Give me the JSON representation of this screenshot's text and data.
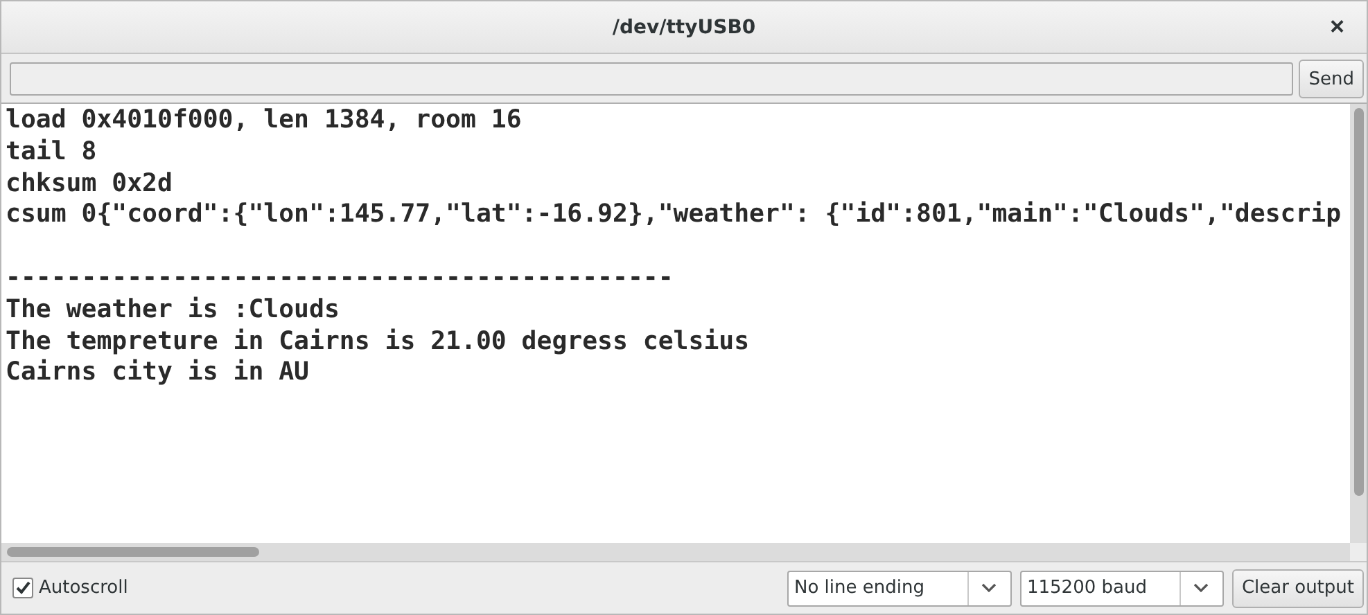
{
  "window": {
    "title": "/dev/ttyUSB0",
    "close": "×"
  },
  "send_bar": {
    "button": "Send"
  },
  "output": {
    "blocks": [
      [
        "load 0x4010f000, len 1384, room 16",
        "tail 8",
        "chksum 0x2d",
        "csum 0{\"coord\":{\"lon\":145.77,\"lat\":-16.92},\"weather\": {\"id\":801,\"main\":\"Clouds\",\"descrip"
      ],
      [
        "--------------------------------------------",
        "The weather is :Clouds",
        "The tempreture in Cairns is 21.00 degress celsius",
        "Cairns city is in AU"
      ]
    ]
  },
  "footer": {
    "autoscroll": {
      "label": "Autoscroll",
      "checked": true
    },
    "line_ending": "No line ending",
    "baud": "115200 baud",
    "clear_button": "Clear output"
  }
}
